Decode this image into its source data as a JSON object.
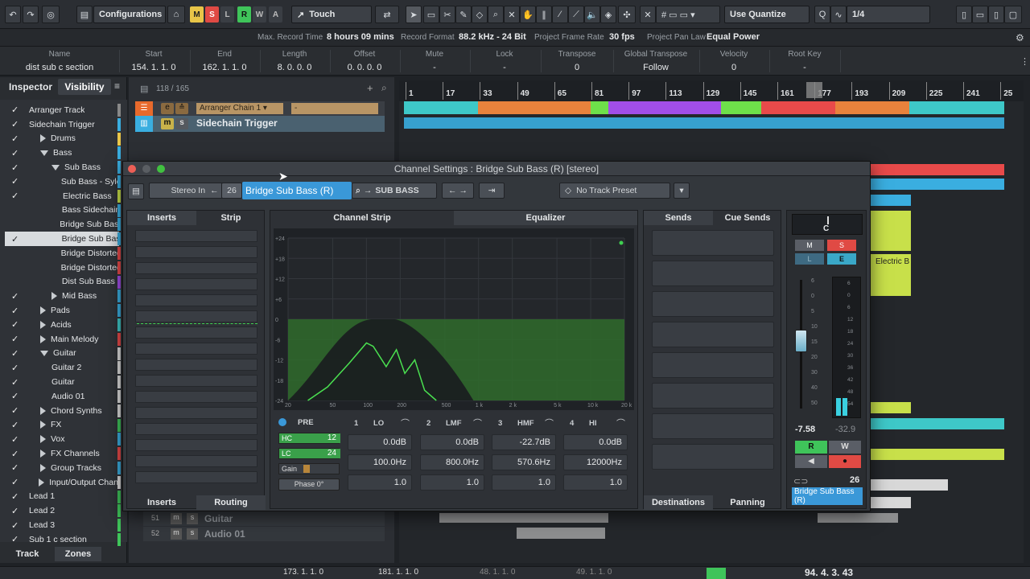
{
  "toolbar": {
    "configurations": "Configurations",
    "modes": [
      "M",
      "S",
      "L",
      "R",
      "W",
      "A"
    ],
    "automation_mode": "Touch",
    "quantize_label": "Use Quantize",
    "quantize_value": "1/4"
  },
  "infoline": {
    "max_record_label": "Max. Record Time",
    "max_record_value": "8 hours 09 mins",
    "record_format_label": "Record Format",
    "record_format_value": "88.2 kHz - 24 Bit",
    "frame_rate_label": "Project Frame Rate",
    "frame_rate_value": "30 fps",
    "pan_law_label": "Project Pan Law",
    "pan_law_value": "Equal Power"
  },
  "eventbar": {
    "name_h": "Name",
    "name_v": "dist sub c section",
    "start_h": "Start",
    "start_v": "154. 1. 1.   0",
    "end_h": "End",
    "end_v": "162. 1. 1.   0",
    "length_h": "Length",
    "length_v": "8. 0. 0.   0",
    "offset_h": "Offset",
    "offset_v": "0. 0. 0.   0",
    "mute_h": "Mute",
    "mute_v": "-",
    "lock_h": "Lock",
    "lock_v": "-",
    "transpose_h": "Transpose",
    "transpose_v": "0",
    "global_transpose_h": "Global Transpose",
    "global_transpose_v": "Follow",
    "velocity_h": "Velocity",
    "velocity_v": "0",
    "root_key_h": "Root Key",
    "root_key_v": "-"
  },
  "inspector": {
    "tab_inspector": "Inspector",
    "tab_visibility": "Visibility",
    "bottom_track": "Track",
    "bottom_zones": "Zones",
    "rows": [
      {
        "label": "Arranger Track",
        "indent": 0,
        "fold": "",
        "checked": true
      },
      {
        "label": "Sidechain Trigger",
        "indent": 0,
        "fold": "",
        "checked": true
      },
      {
        "label": "Drums",
        "indent": 1,
        "fold": "r",
        "checked": true
      },
      {
        "label": "Bass",
        "indent": 1,
        "fold": "d",
        "checked": true
      },
      {
        "label": "Sub Bass",
        "indent": 2,
        "fold": "d",
        "checked": true
      },
      {
        "label": "Sub Bass - Syle",
        "indent": 3,
        "fold": "",
        "checked": true
      },
      {
        "label": "Electric Bass",
        "indent": 3,
        "fold": "",
        "checked": true
      },
      {
        "label": "Bass Sidechain",
        "indent": 3,
        "fold": "",
        "checked": false
      },
      {
        "label": "Bridge Sub Bass",
        "indent": 3,
        "fold": "",
        "checked": false
      },
      {
        "label": "Bridge Sub Bas",
        "indent": 3,
        "fold": "",
        "checked": true,
        "selected": true
      },
      {
        "label": "Bridge Distorted",
        "indent": 3,
        "fold": "",
        "checked": false
      },
      {
        "label": "Bridge Distorted",
        "indent": 3,
        "fold": "",
        "checked": false
      },
      {
        "label": "Dist Sub Bass -",
        "indent": 3,
        "fold": "",
        "checked": false
      },
      {
        "label": "Mid Bass",
        "indent": 2,
        "fold": "r",
        "checked": true
      },
      {
        "label": "Pads",
        "indent": 1,
        "fold": "r",
        "checked": true
      },
      {
        "label": "Acids",
        "indent": 1,
        "fold": "r",
        "checked": true
      },
      {
        "label": "Main Melody",
        "indent": 1,
        "fold": "r",
        "checked": true
      },
      {
        "label": "Guitar",
        "indent": 1,
        "fold": "d",
        "checked": true
      },
      {
        "label": "Guitar 2",
        "indent": 2,
        "fold": "",
        "checked": true
      },
      {
        "label": "Guitar",
        "indent": 2,
        "fold": "",
        "checked": true
      },
      {
        "label": "Audio 01",
        "indent": 2,
        "fold": "",
        "checked": true
      },
      {
        "label": "Chord Synths",
        "indent": 1,
        "fold": "r",
        "checked": true
      },
      {
        "label": "FX",
        "indent": 1,
        "fold": "r",
        "checked": true
      },
      {
        "label": "Vox",
        "indent": 1,
        "fold": "r",
        "checked": true
      },
      {
        "label": "FX Channels",
        "indent": 1,
        "fold": "r",
        "checked": true
      },
      {
        "label": "Group Tracks",
        "indent": 1,
        "fold": "r",
        "checked": true
      },
      {
        "label": "Input/Output Chann",
        "indent": 1,
        "fold": "r",
        "checked": true
      },
      {
        "label": "Lead 1",
        "indent": 0,
        "fold": "",
        "checked": true
      },
      {
        "label": "Lead 2",
        "indent": 0,
        "fold": "",
        "checked": true
      },
      {
        "label": "Lead 3",
        "indent": 0,
        "fold": "",
        "checked": true
      },
      {
        "label": "Sub 1 c section",
        "indent": 0,
        "fold": "",
        "checked": true
      }
    ]
  },
  "tracklist": {
    "count": "118 / 165",
    "arranger_track": "Arranger Chain 1",
    "arranger_dash": "-",
    "sidechain_track": "Sidechain Trigger",
    "row51_num": "51",
    "row51_name": "Guitar",
    "row52_num": "52",
    "row52_name": "Audio 01"
  },
  "ruler": {
    "marks": [
      "1",
      "17",
      "33",
      "49",
      "65",
      "81",
      "97",
      "113",
      "129",
      "145",
      "161",
      "177",
      "193",
      "209",
      "225",
      "241",
      "25"
    ]
  },
  "channel_settings": {
    "title": "Channel Settings : Bridge Sub Bass (R) [stereo]",
    "input": "Stereo In",
    "channel_num": "26",
    "channel_name": "Bridge Sub Bass (R)",
    "output": "SUB BASS",
    "preset": "No Track Preset",
    "tab_inserts": "Inserts",
    "tab_strip": "Strip",
    "channel_strip": "Channel Strip",
    "equalizer": "Equalizer",
    "tab_sends": "Sends",
    "tab_cue_sends": "Cue Sends",
    "bottom_inserts": "Inserts",
    "bottom_routing": "Routing",
    "bottom_destinations": "Destinations",
    "bottom_panning": "Panning",
    "eq_db_labels": [
      "+24",
      "+18",
      "+12",
      "+6",
      "0",
      "-6",
      "-12",
      "-18",
      "-24"
    ],
    "eq_freq_labels": [
      "20",
      "50",
      "100",
      "200",
      "500",
      "1 k",
      "2 k",
      "5 k",
      "10 k",
      "20 k"
    ],
    "pre": {
      "label": "PRE",
      "hc": "HC",
      "hc_val": "12",
      "lc": "LC",
      "lc_val": "24",
      "gain": "Gain",
      "phase": "Phase 0°"
    },
    "bands": [
      {
        "num": "1",
        "name": "LO",
        "gain": "0.0dB",
        "freq": "100.0Hz",
        "q": "1.0"
      },
      {
        "num": "2",
        "name": "LMF",
        "gain": "0.0dB",
        "freq": "800.0Hz",
        "q": "1.0"
      },
      {
        "num": "3",
        "name": "HMF",
        "gain": "-22.7dB",
        "freq": "570.6Hz",
        "q": "1.0"
      },
      {
        "num": "4",
        "name": "HI",
        "gain": "0.0dB",
        "freq": "12000Hz",
        "q": "1.0"
      }
    ],
    "fader": {
      "pan": "C",
      "m": "M",
      "s": "S",
      "l": "L",
      "e": "E",
      "scale": [
        "6",
        "0",
        "5",
        "10",
        "15",
        "20",
        "30",
        "40",
        "50"
      ],
      "meter_scale": [
        "6",
        "0",
        "6",
        "12",
        "18",
        "24",
        "30",
        "36",
        "42",
        "48",
        "54"
      ],
      "value": "-7.58",
      "peak": "-32.9",
      "r": "R",
      "w": "W",
      "channel_num": "26",
      "channel_name": "Bridge Sub Bass (R)"
    }
  },
  "transport": {
    "pos1": "173. 1. 1.   0",
    "pos2": "181. 1. 1.   0",
    "pos3": "48. 1. 1.   0",
    "pos4": "49. 1. 1.   0",
    "time": "94. 4. 3. 43"
  }
}
